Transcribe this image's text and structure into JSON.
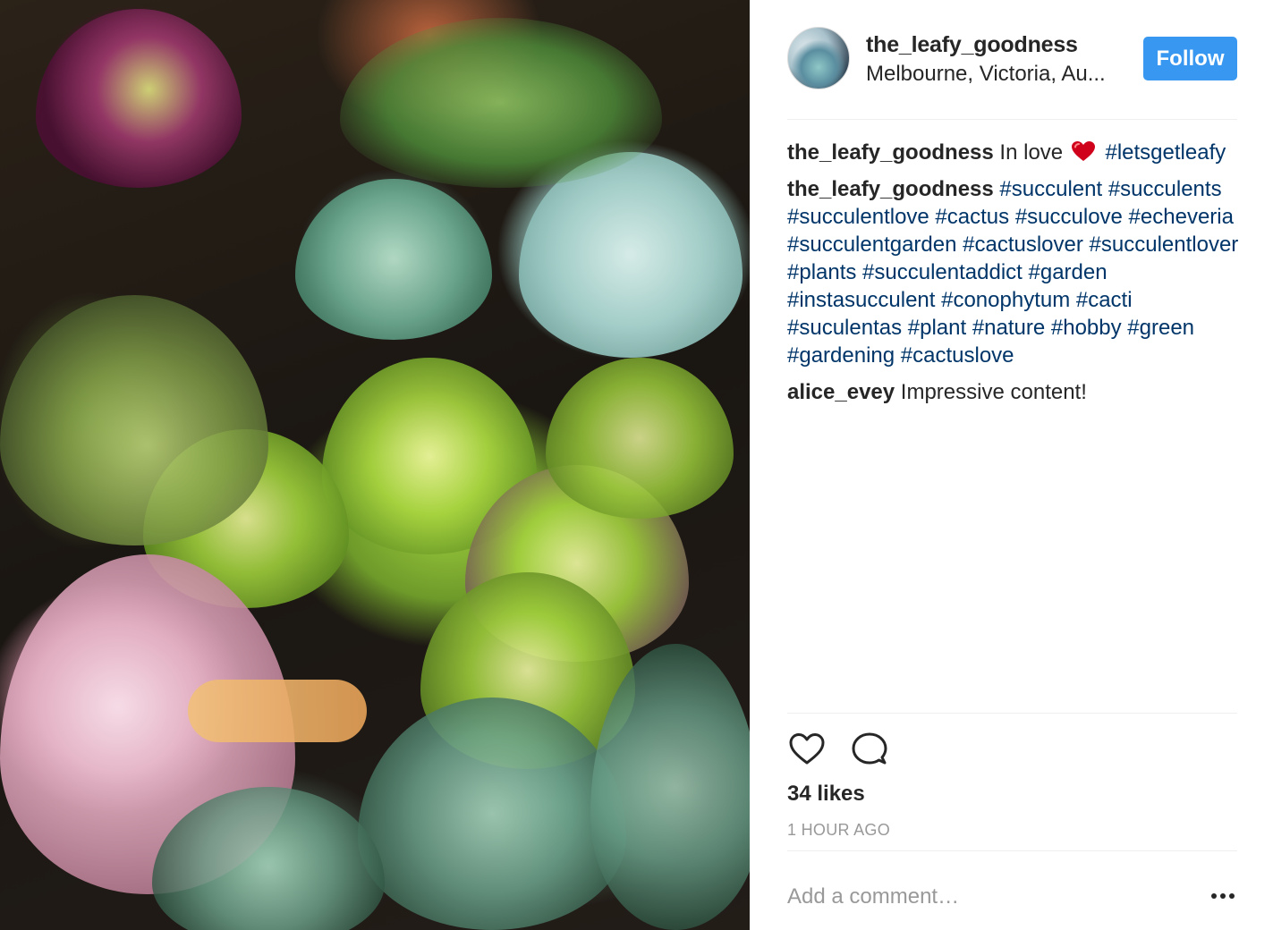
{
  "post": {
    "author": {
      "username": "the_leafy_goodness",
      "location": "Melbourne, Victoria, Au..."
    },
    "follow_label": "Follow",
    "comments": [
      {
        "username": "the_leafy_goodness",
        "text": "In love",
        "emoji": "red-heart-emoji",
        "hashtags": "#letsgetleafy"
      },
      {
        "username": "the_leafy_goodness",
        "hashtags": "#succulent #succulents #succulentlove #cactus #succulove #echeveria #succulentgarden #cactuslover #succulentlover #plants #succulentaddict #garden #instasucculent #conophytum #cacti #suculentas #plant #nature #hobby #green #gardening #cactuslove"
      },
      {
        "username": "alice_evey",
        "text": "Impressive content!"
      }
    ],
    "likes": "34 likes",
    "timestamp": "1 HOUR AGO",
    "add_comment_placeholder": "Add a comment…",
    "icons": {
      "like": "heart-outline-icon",
      "comment": "comment-bubble-icon",
      "more": "more-options-icon"
    }
  },
  "colors": {
    "follow_button": "#3897f0",
    "hashtag": "#003569",
    "text": "#262626",
    "muted": "#999999",
    "divider": "#efefef"
  }
}
